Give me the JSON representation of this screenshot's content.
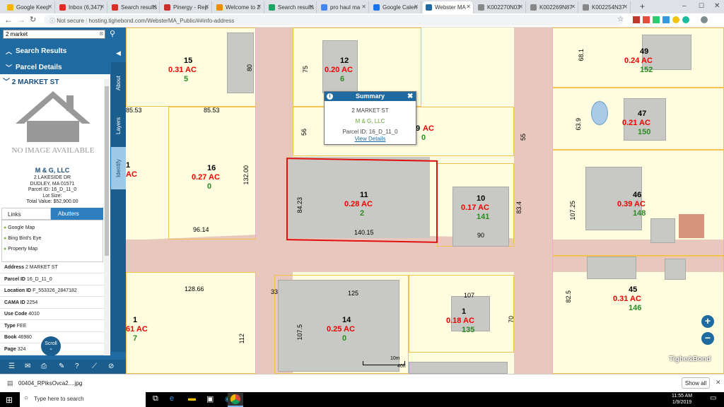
{
  "tabs": [
    {
      "label": "Google Keep",
      "color": "#f6b400"
    },
    {
      "label": "Inbox (6,347)",
      "color": "#d93025"
    },
    {
      "label": "Search results",
      "color": "#d93025"
    },
    {
      "label": "Pinergy - Rep",
      "color": "#c9302c"
    },
    {
      "label": "Welcome to 2",
      "color": "#f08c00"
    },
    {
      "label": "Search results",
      "color": "#1fa463"
    },
    {
      "label": "pro haul ma",
      "color": "#4285f4"
    },
    {
      "label": "Google Calen",
      "color": "#1a73e8"
    },
    {
      "label": "Webster MA",
      "color": "#1f6aa0"
    },
    {
      "label": "K002270N03",
      "color": "#888888"
    },
    {
      "label": "K002269N87",
      "color": "#888888"
    },
    {
      "label": "K002254N37",
      "color": "#888888"
    }
  ],
  "address": {
    "not_secure": "Not secure",
    "url": "hosting.tighebond.com/WebsterMA_Public/##info-address"
  },
  "search": {
    "value": "2 market"
  },
  "panel": {
    "search_results": "Search Results",
    "parcel_details": "Parcel Details",
    "address_title": "2 MARKET ST",
    "no_image": "NO IMAGE AVAILABLE",
    "owner": "M & G, LLC",
    "owner_addr1": "2 LAKESIDE DR",
    "owner_addr2": "DUDLEY, MA 01571",
    "parcel_id_line": "Parcel ID: 16_D_11_0",
    "lot_size_line": "Lot Size:",
    "total_value_line": "Total Value: $52,900.00",
    "tab_links": "Links",
    "tab_abutters": "Abutters",
    "links": [
      "Google Map",
      "Bing Bird's Eye",
      "Property Map"
    ],
    "fields": [
      {
        "label": "Address",
        "value": "2 MARKET ST"
      },
      {
        "label": "Parcel ID",
        "value": "16_D_11_0"
      },
      {
        "label": "Location ID",
        "value": "F_553326_2847182"
      },
      {
        "label": "CAMA ID",
        "value": "2254"
      },
      {
        "label": "Use Code",
        "value": "4010"
      },
      {
        "label": "Type",
        "value": "FEE"
      },
      {
        "label": "Book",
        "value": "46980"
      },
      {
        "label": "Page",
        "value": "324"
      }
    ],
    "scroll_label": "Scroll",
    "vtabs": [
      "About",
      "Layers",
      "Identify"
    ]
  },
  "popup": {
    "title": "Summary",
    "address": "2 MARKET ST",
    "owner": "M & G, LLC",
    "parcel_id": "Parcel ID: 16_D_11_0",
    "link": "View Details"
  },
  "parcels": [
    {
      "num": "15",
      "ac": "0.31 AC",
      "cnt": "5"
    },
    {
      "num": "12",
      "ac": "0.20 AC",
      "cnt": "6"
    },
    {
      "num": "49",
      "ac": "0.24 AC",
      "cnt": "152"
    },
    {
      "num": "47",
      "ac": "0.21 AC",
      "cnt": "150"
    },
    {
      "num": "16",
      "ac": "0.27 AC",
      "cnt": "0"
    },
    {
      "num": "11",
      "ac": "0.28 AC",
      "cnt": "2"
    },
    {
      "num": "10",
      "ac": "0.17 AC",
      "cnt": "141"
    },
    {
      "num": "46",
      "ac": "0.39 AC",
      "cnt": "148"
    },
    {
      "num": "14",
      "ac": "0.25 AC",
      "cnt": "0"
    },
    {
      "num": "1",
      "ac": "0.18 AC",
      "cnt": "135"
    },
    {
      "num": "45",
      "ac": "0.31 AC",
      "cnt": "146"
    },
    {
      "num": "1",
      "ac": "61 AC",
      "cnt": "7"
    },
    {
      "num": "1",
      "ac": "AC",
      "cnt": ""
    },
    {
      "num": "9",
      "ac": "AC",
      "cnt": "0"
    }
  ],
  "dims": [
    "80",
    "75",
    "68.1",
    "85.53",
    "85.53",
    "56",
    "63.9",
    "55",
    "132.00",
    "84.23",
    "140.15",
    "83.4",
    "107.25",
    "96.14",
    "90",
    "128.66",
    "33",
    "125",
    "107",
    "82.5",
    "107.5",
    "70",
    "112"
  ],
  "scale": {
    "m": "10m",
    "ft": "40ft"
  },
  "brand": "Tighe&Bond",
  "download": {
    "file": "00404_RPiksOvca2....jpg",
    "show_all": "Show all"
  },
  "taskbar": {
    "search": "Type here to search",
    "time": "11:55 AM",
    "date": "1/9/2019"
  }
}
